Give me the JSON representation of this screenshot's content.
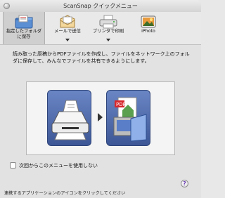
{
  "window": {
    "title": "ScanSnap クイックメニュー"
  },
  "toolbar": {
    "items": [
      {
        "label": "指定したフォルダ\nに保存",
        "icon": "folder-save-icon",
        "selected": true,
        "has_menu": false
      },
      {
        "label": "メールで送信",
        "icon": "mail-icon",
        "selected": false,
        "has_menu": true
      },
      {
        "label": "プリンタで印刷",
        "icon": "printer-icon",
        "selected": false,
        "has_menu": true
      },
      {
        "label": "iPhoto",
        "icon": "iphoto-icon",
        "selected": false,
        "has_menu": false
      }
    ]
  },
  "main": {
    "description": "読み取った原稿からPDFファイルを作成し、ファイルをネットワーク上のフォルダに保存して、みんなでファイルを共有できるようにします。",
    "illustration": {
      "left_icon": "scanner-icon",
      "right_icon": "pdf-folder-icon",
      "badge": "PDF"
    },
    "checkbox": {
      "label": "次回からこのメニューを使用しない",
      "checked": false
    },
    "footer": "連携するアプリケーションのアイコンをクリックしてください"
  }
}
